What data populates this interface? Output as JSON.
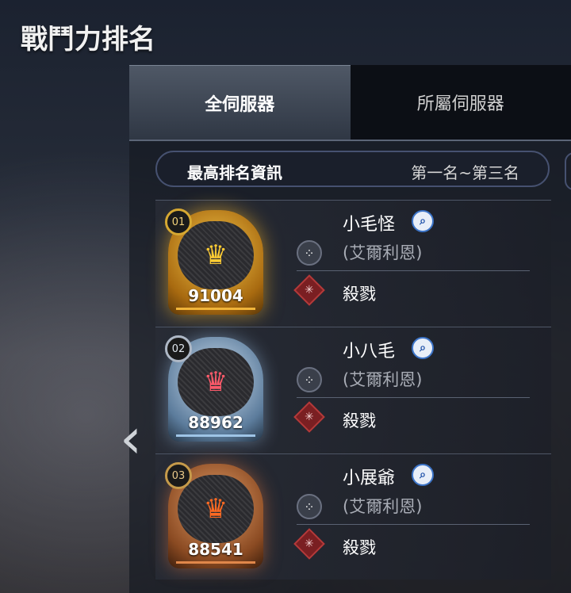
{
  "page_title": "戰鬥力排名",
  "tabs": [
    {
      "label": "全伺服器",
      "active": true
    },
    {
      "label": "所屬伺服器",
      "active": false
    }
  ],
  "info_bar": {
    "label": "最高排名資訊",
    "range": "第一名~第三名"
  },
  "nav": {
    "prev_icon": "chevron-left-icon"
  },
  "rankings": [
    {
      "rank": "01",
      "power": "91004",
      "name": "小毛怪",
      "server": "(艾爾利恩)",
      "title": "殺戮",
      "medal": "gold",
      "accent": "#f0b43a"
    },
    {
      "rank": "02",
      "power": "88962",
      "name": "小八毛",
      "server": "(艾爾利恩)",
      "title": "殺戮",
      "medal": "silver",
      "accent": "#9ec4e6"
    },
    {
      "rank": "03",
      "power": "88541",
      "name": "小展爺",
      "server": "(艾爾利恩)",
      "title": "殺戮",
      "medal": "bronze",
      "accent": "#e0874a"
    }
  ]
}
